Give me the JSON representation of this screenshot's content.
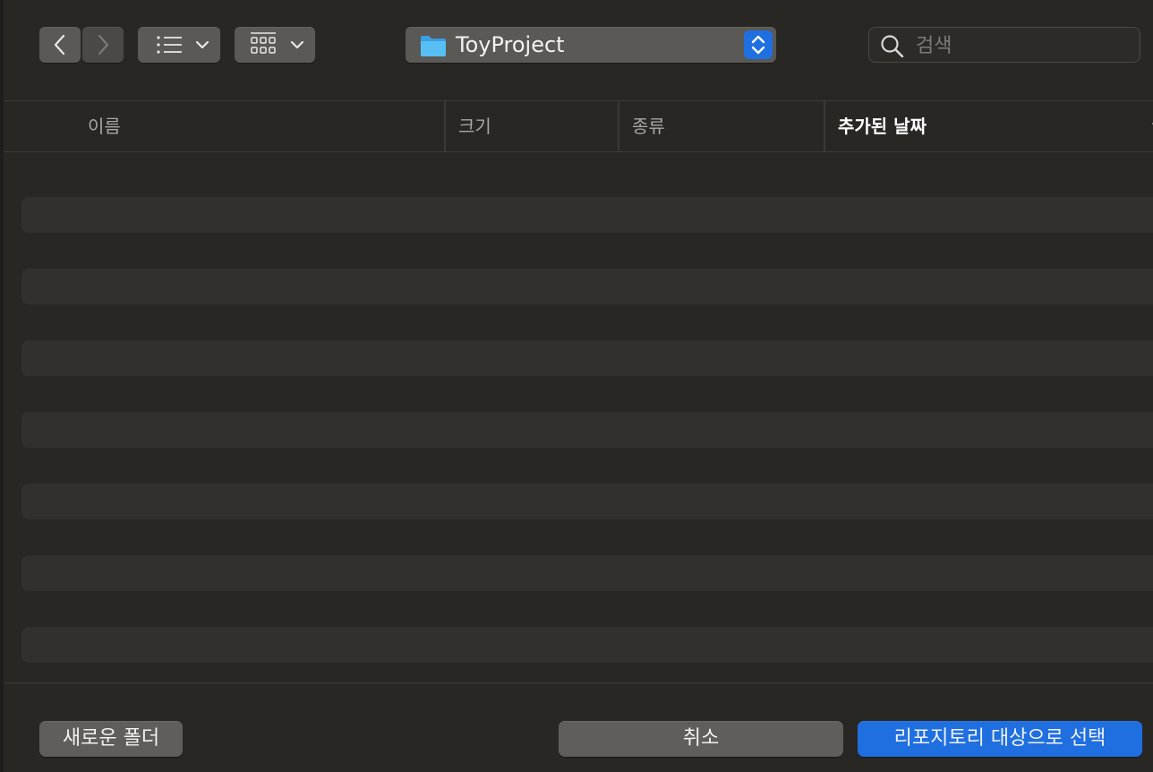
{
  "toolbar": {
    "back_icon": "chevron-left-icon",
    "forward_icon": "chevron-right-icon",
    "list_view_icon": "list-icon",
    "grid_view_icon": "grid-icon",
    "path": {
      "folder_icon": "folder-icon",
      "label": "ToyProject"
    },
    "search": {
      "placeholder": "검색",
      "value": ""
    }
  },
  "columns": {
    "name": "이름",
    "size": "크기",
    "kind": "종류",
    "date_added": "추가된 날짜"
  },
  "footer": {
    "new_folder": "새로운 폴더",
    "cancel": "취소",
    "select": "리포지토리 대상으로 선택"
  },
  "colors": {
    "background": "#282724",
    "accent": "#1f6fe0",
    "button": "#5f5e5a",
    "stripe": "#31302d",
    "folder": "#4fb6f0"
  }
}
